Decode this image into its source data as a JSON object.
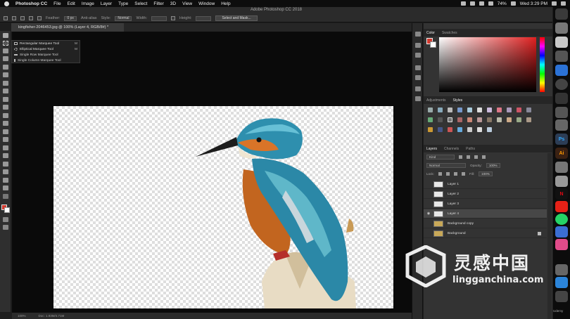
{
  "menubar": {
    "app_name": "Photoshop CC",
    "menus": [
      "File",
      "Edit",
      "Image",
      "Layer",
      "Type",
      "Select",
      "Filter",
      "3D",
      "View",
      "Window",
      "Help"
    ],
    "battery": "74%",
    "clock": "Wed 3:29 PM"
  },
  "window": {
    "title": "Adobe Photoshop CC 2018"
  },
  "options": {
    "feather_label": "Feather:",
    "feather_value": "0 px",
    "antialias_label": "Anti-alias",
    "style_label": "Style:",
    "style_value": "Normal",
    "width_label": "Width:",
    "height_label": "Height:",
    "select_mask_label": "Select and Mask..."
  },
  "document_tab": {
    "label": "kingfisher-2046453.jpg @ 100% (Layer 4, RGB/8#) *"
  },
  "flyout": {
    "items": [
      {
        "label": "Rectangular Marquee Tool",
        "key": "M"
      },
      {
        "label": "Elliptical Marquee Tool",
        "key": "M"
      },
      {
        "label": "Single Row Marquee Tool",
        "key": ""
      },
      {
        "label": "Single Column Marquee Tool",
        "key": ""
      }
    ]
  },
  "status": {
    "zoom": "100%",
    "doc": "Doc: 1.93M/4.71M"
  },
  "color_panel": {
    "tabs": [
      "Color",
      "Swatches"
    ],
    "fg_color": "#d43a2f",
    "bg_color": "#ffffff"
  },
  "adjust_panel": {
    "tabs": [
      "Adjustments",
      "Styles"
    ]
  },
  "layers_panel": {
    "tabs": [
      "Layers",
      "Channels",
      "Paths"
    ],
    "kind_label": "Kind",
    "blend_mode": "Normal",
    "opacity_label": "Opacity:",
    "opacity_value": "100%",
    "lock_label": "Lock:",
    "fill_label": "Fill:",
    "fill_value": "100%",
    "layers": [
      {
        "name": "Layer 1",
        "selected": false,
        "visible": false
      },
      {
        "name": "Layer 2",
        "selected": false,
        "visible": false
      },
      {
        "name": "Layer 3",
        "selected": false,
        "visible": false
      },
      {
        "name": "Layer 4",
        "selected": true,
        "visible": true
      },
      {
        "name": "Background copy",
        "selected": false,
        "visible": false
      },
      {
        "name": "Background",
        "selected": false,
        "visible": false
      }
    ]
  },
  "dock": {
    "ps_label": "Ps",
    "ai_label": "Ai"
  },
  "watermark": {
    "main": "灵感中国",
    "sub": "lingganchina.com"
  },
  "udemy_label": "Udemy"
}
